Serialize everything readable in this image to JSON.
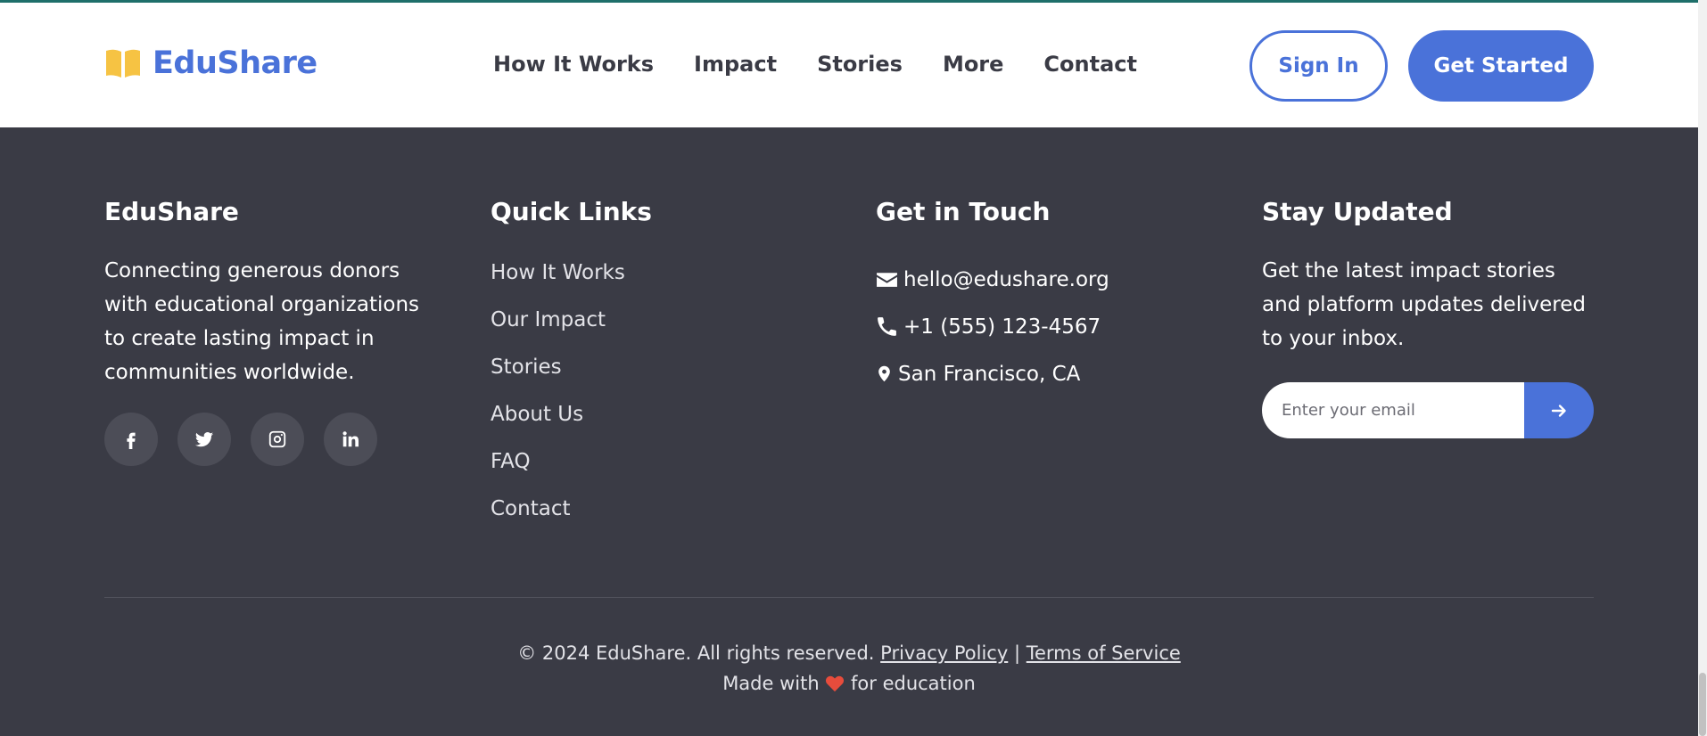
{
  "brand": {
    "name": "EduShare",
    "accent_color": "#4a72d9",
    "logo_color": "#f6c343",
    "logo_icon": "book-open-icon"
  },
  "header": {
    "nav": [
      "How It Works",
      "Impact",
      "Stories",
      "More",
      "Contact"
    ],
    "sign_in_label": "Sign In",
    "get_started_label": "Get Started"
  },
  "footer": {
    "about": {
      "title": "EduShare",
      "text": "Connecting generous donors with educational organizations to create lasting impact in communities worldwide.",
      "socials": [
        "facebook-icon",
        "twitter-icon",
        "instagram-icon",
        "linkedin-icon"
      ]
    },
    "quick_links": {
      "title": "Quick Links",
      "items": [
        "How It Works",
        "Our Impact",
        "Stories",
        "About Us",
        "FAQ",
        "Contact"
      ]
    },
    "contact": {
      "title": "Get in Touch",
      "email": "hello@edushare.org",
      "phone": "+1 (555) 123-4567",
      "location": "San Francisco, CA"
    },
    "newsletter": {
      "title": "Stay Updated",
      "text": "Get the latest impact stories and platform updates delivered to your inbox.",
      "placeholder": "Enter your email"
    },
    "bottom": {
      "copyright": "© 2024 EduShare. All rights reserved.",
      "privacy": "Privacy Policy",
      "separator": "|",
      "terms": "Terms of Service",
      "made_with": "Made with",
      "for_education": "for education",
      "heart_color": "#e74c3c"
    }
  }
}
